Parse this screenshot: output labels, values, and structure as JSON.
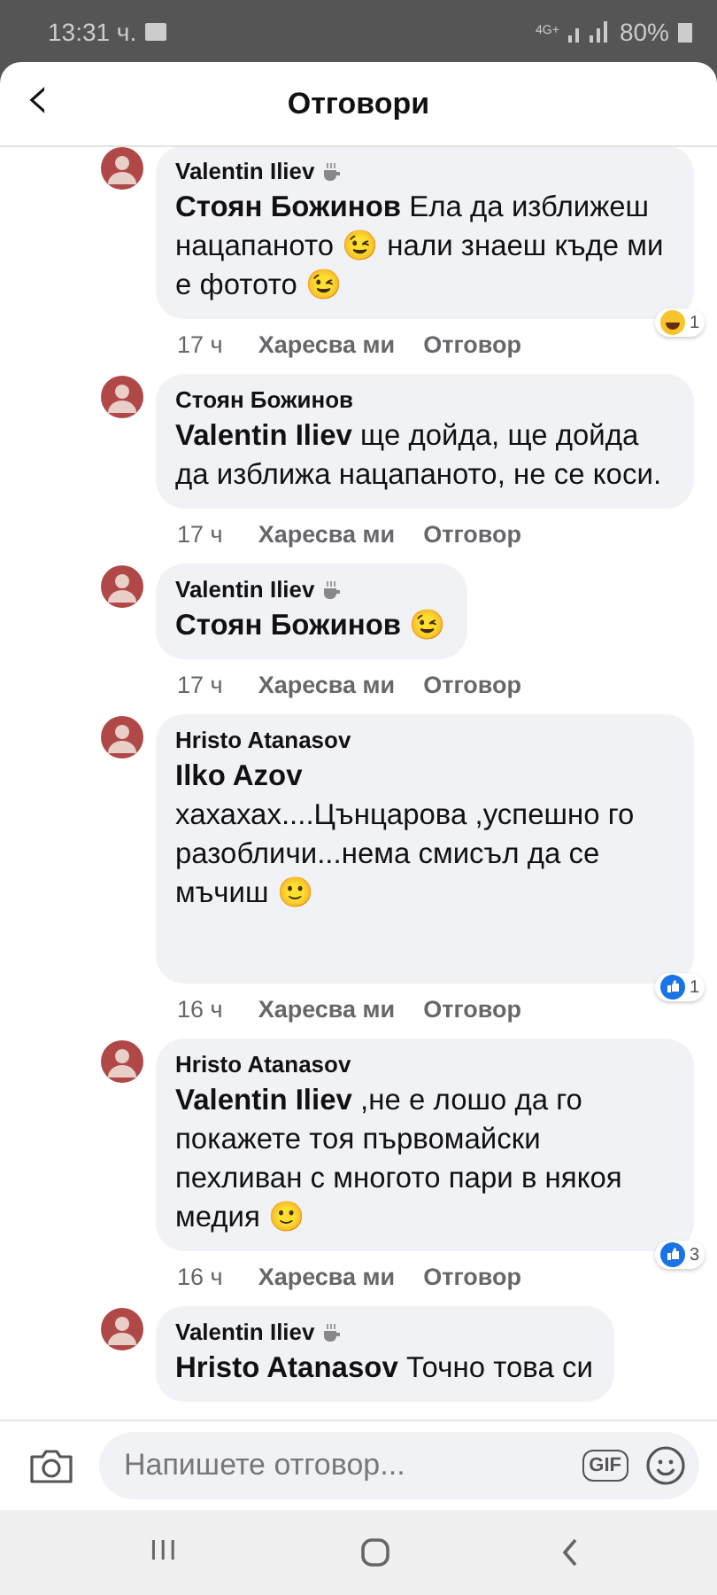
{
  "status_bar": {
    "time": "13:31 ч.",
    "battery": "80%",
    "network": "4G+"
  },
  "header": {
    "back": "‹",
    "title": "Отговори"
  },
  "comments": [
    {
      "author": "Valentin Iliev",
      "coffee_badge": true,
      "tall": false,
      "text": "**Стоян Божинов** Ела да изближеш нацапаното 😉 нали знаеш къде ми е фотото 😉",
      "time": "17 ч",
      "like": "Харесва ми",
      "reply": "Отговор",
      "reaction": {
        "kind": "laugh",
        "count": "1"
      }
    },
    {
      "author": "Стоян Божинов",
      "coffee_badge": false,
      "tall": false,
      "text": "**Valentin Iliev** ще дойда, ще дойда да изближа нацапаното, не се коси.",
      "time": "17 ч",
      "like": "Харесва ми",
      "reply": "Отговор"
    },
    {
      "author": "Valentin Iliev",
      "coffee_badge": true,
      "tall": false,
      "text": "**Стоян Божинов** 😉",
      "time": "17 ч",
      "like": "Харесва ми",
      "reply": "Отговор"
    },
    {
      "author": "Hristo Atanasov",
      "coffee_badge": false,
      "text": "**Ilko Azov**\nхахахах....Цънцарова ,успешно го разобличи...нема смисъл да се мъчиш 🙂",
      "tall": true,
      "time": "16 ч",
      "like": "Харесва ми",
      "reply": "Отговор",
      "reaction": {
        "kind": "like",
        "count": "1"
      }
    },
    {
      "author": "Hristo Atanasov",
      "coffee_badge": false,
      "tall": false,
      "text": "**Valentin Iliev** ,не е лошо да го покажете тоя първомайски пехливан с многото пари в някоя медия 🙂",
      "time": "16 ч",
      "like": "Харесва ми",
      "reply": "Отговор",
      "reaction": {
        "kind": "like",
        "count": "3"
      }
    },
    {
      "author": "Valentin Iliev",
      "coffee_badge": true,
      "tall": false,
      "text": "**Hristo Atanasov** Точно това си"
    }
  ],
  "composer": {
    "placeholder": "Напишете отговор...",
    "gif": "GIF"
  },
  "nav": {
    "recents": "III"
  }
}
